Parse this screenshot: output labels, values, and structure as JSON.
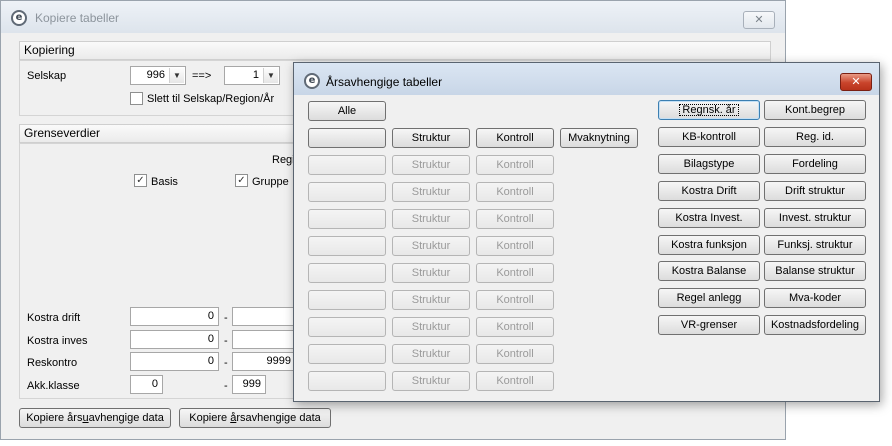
{
  "back_window": {
    "title": "Kopiere tabeller",
    "close_glyph": "✕",
    "kopiering": {
      "header": "Kopiering",
      "selskap_label": "Selskap",
      "selskap_from": "996",
      "arrow": "==>",
      "selskap_to": "1",
      "slett_checkbox_label": "Slett til Selskap/Region/År",
      "slett_checked": false
    },
    "grenseverdier": {
      "header": "Grenseverdier",
      "regi_label": "Regi",
      "basis_label": "Basis",
      "basis_checked": true,
      "gruppe_label": "Gruppe",
      "gruppe_checked": true,
      "rows": [
        {
          "label": "Kostra drift",
          "from": "0",
          "dash": "-",
          "to": ""
        },
        {
          "label": "Kostra inves",
          "from": "0",
          "dash": "-",
          "to": ""
        },
        {
          "label": "Reskontro",
          "from": "0",
          "dash": "-",
          "to": "9999"
        },
        {
          "label": "Akk.klasse",
          "from": "0",
          "dash": "-",
          "to": "999"
        }
      ]
    },
    "bottom_buttons": {
      "uavhengige_pre": "Kopiere års",
      "uavhengige_u": "u",
      "uavhengige_post": "avhengige data",
      "avhengige_pre": "Kopiere ",
      "avhengige_u": "å",
      "avhengige_post": "rsavhengige data"
    }
  },
  "dialog": {
    "title": "Årsavhengige tabeller",
    "close_glyph": "✕",
    "alle_button": "Alle",
    "struktur_label": "Struktur",
    "kontroll_label": "Kontroll",
    "mvaknytning_button": "Mvaknytning",
    "right_buttons": [
      [
        "Regnsk. år",
        "Kont.begrep"
      ],
      [
        "KB-kontroll",
        "Reg. id."
      ],
      [
        "Bilagstype",
        "Fordeling"
      ],
      [
        "Kostra Drift",
        "Drift struktur"
      ],
      [
        "Kostra Invest.",
        "Invest. struktur"
      ],
      [
        "Kostra funksjon",
        "Funksj. struktur"
      ],
      [
        "Kostra Balanse",
        "Balanse struktur"
      ],
      [
        "Regel anlegg",
        "Mva-koder"
      ],
      [
        "VR-grenser",
        "Kostnadsfordeling"
      ]
    ]
  }
}
